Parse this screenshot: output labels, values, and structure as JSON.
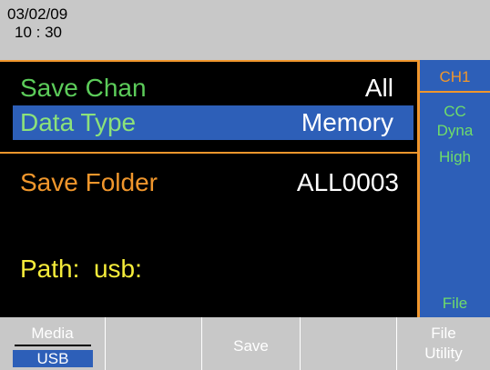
{
  "status": {
    "date": "03/02/09",
    "time": "10 : 30"
  },
  "settings": {
    "save_chan": {
      "label": "Save Chan",
      "value": "All"
    },
    "data_type": {
      "label": "Data Type",
      "value": "Memory"
    },
    "save_folder": {
      "label": "Save Folder",
      "value": "ALL0003"
    },
    "path": {
      "text": "Path:  usb:"
    }
  },
  "channel": {
    "label": "CH1",
    "mode1": "CC",
    "mode2": "Dyna",
    "mode3": "High",
    "mode4": "File"
  },
  "softkeys": {
    "media": {
      "top": "Media",
      "bottom": "USB"
    },
    "save": "Save",
    "file_utility": {
      "top": "File",
      "bottom": "Utility"
    }
  },
  "colors": {
    "accent": "#f0962c",
    "highlight": "#2d5fb8",
    "label_green": "#5ccc5a",
    "path_yellow": "#f5ec3a"
  }
}
